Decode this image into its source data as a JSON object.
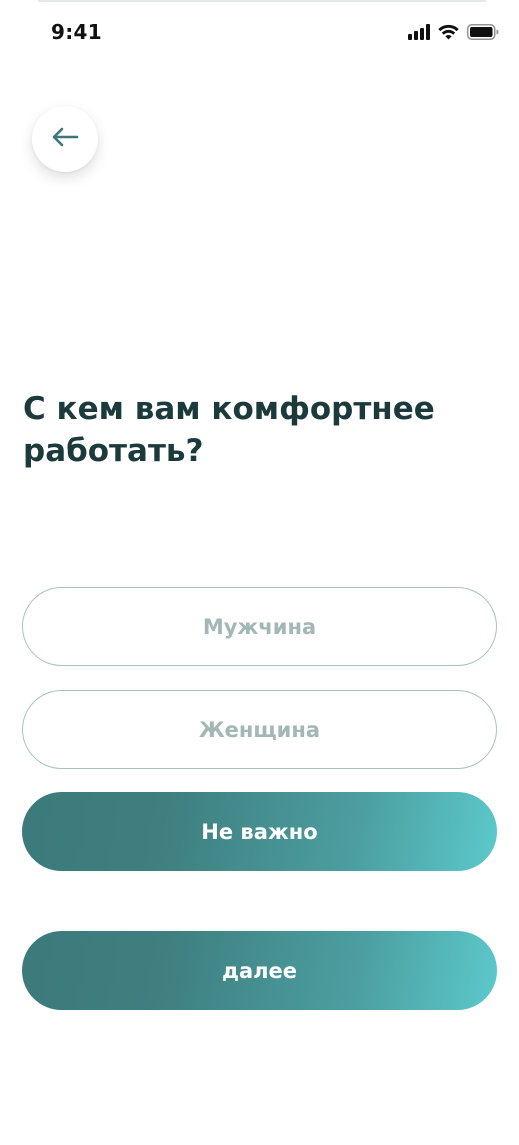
{
  "status_bar": {
    "time": "9:41",
    "icons": [
      "signal-icon",
      "wifi-icon",
      "battery-icon"
    ]
  },
  "header": {
    "back_icon": "arrow-left-icon"
  },
  "question": {
    "title": "С кем вам комфортнее работать?"
  },
  "options": [
    {
      "label": "Мужчина",
      "selected": false
    },
    {
      "label": "Женщина",
      "selected": false
    },
    {
      "label": "Не важно",
      "selected": true
    }
  ],
  "next_button": {
    "label": "далее"
  },
  "colors": {
    "accent_start": "#3c7a7b",
    "accent_end": "#5cc9cb",
    "title": "#1c3a3b",
    "outline_border": "#a9c2c1",
    "outline_text": "#a3b7b6"
  }
}
